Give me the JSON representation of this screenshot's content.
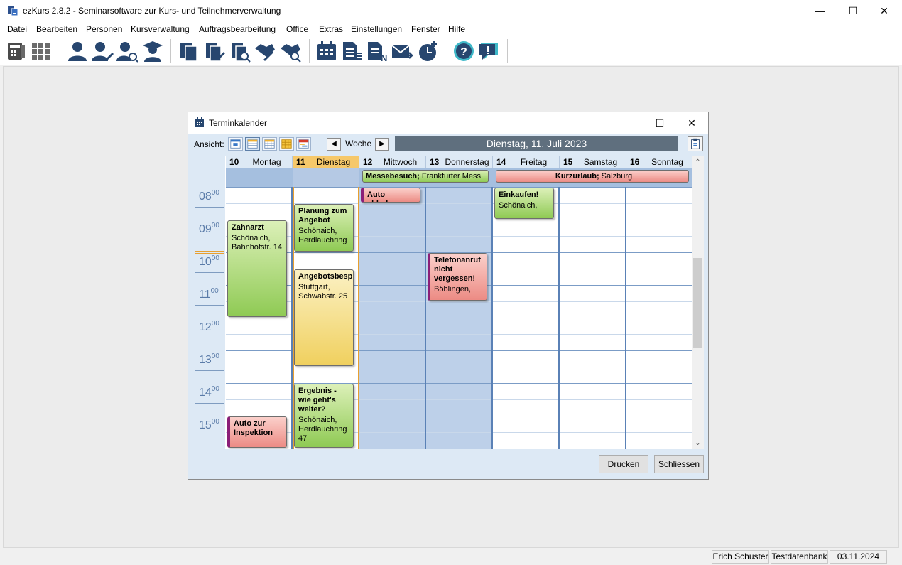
{
  "window": {
    "title": "ezKurs 2.8.2  -  Seminarsoftware zur Kurs- und Teilnehmerverwaltung",
    "minimize": "—",
    "maximize": "☐",
    "close": "✕"
  },
  "menu": [
    "Datei",
    "Bearbeiten",
    "Personen",
    "Kursverwaltung",
    "Auftragsbearbeitung",
    "Office",
    "Extras",
    "Einstellungen",
    "Fenster",
    "Hilfe"
  ],
  "toolbar_icons": [
    "calculator-book",
    "grid-view",
    "person",
    "person-edit",
    "person-search",
    "graduate",
    "documents",
    "document-edit",
    "document-search",
    "handshake-edit",
    "handshake-search",
    "calendar",
    "report-list",
    "report-n",
    "mail-send",
    "timer-add",
    "help",
    "feedback"
  ],
  "dialog": {
    "title": "Terminkalender",
    "ansicht_label": "Ansicht:",
    "woche_label": "Woche",
    "prev": "◀",
    "next": "▶",
    "current_date": "Dienstag, 11. Juli 2023",
    "print_button": "Drucken",
    "close_button": "Schliessen",
    "hours": [
      {
        "h": "08",
        "m": "00"
      },
      {
        "h": "09",
        "m": "00"
      },
      {
        "h": "10",
        "m": "00"
      },
      {
        "h": "11",
        "m": "00"
      },
      {
        "h": "12",
        "m": "00"
      },
      {
        "h": "13",
        "m": "00"
      },
      {
        "h": "14",
        "m": "00"
      },
      {
        "h": "15",
        "m": "00"
      }
    ],
    "days": [
      {
        "num": "10",
        "name": "Montag"
      },
      {
        "num": "11",
        "name": "Dienstag"
      },
      {
        "num": "12",
        "name": "Mittwoch"
      },
      {
        "num": "13",
        "name": "Donnerstag"
      },
      {
        "num": "14",
        "name": "Freitag"
      },
      {
        "num": "15",
        "name": "Samstag"
      },
      {
        "num": "16",
        "name": "Sonntag"
      }
    ],
    "allday_events": [
      {
        "title": "Messebesuch;",
        "location": " Frankfurter Mess",
        "color": "green"
      },
      {
        "title": "Kurzurlaub;",
        "location": " Salzburg",
        "color": "red"
      }
    ],
    "events": [
      {
        "title": "Zahnarzt",
        "location": "Schönaich, Bahnhofstr. 14",
        "color": "green",
        "day": "Montag",
        "start": "09:00",
        "end": "12:00"
      },
      {
        "title": "Auto zur Inspektion",
        "location": "",
        "color": "red",
        "day": "Montag",
        "start": "15:00",
        "end": "16:00"
      },
      {
        "title": "Planung zum Angebot",
        "location": "Schönaich, Herdlauchring",
        "color": "green",
        "day": "Dienstag",
        "start": "08:30",
        "end": "10:00"
      },
      {
        "title": "Angebotsbesprechung",
        "location": "Stuttgart, Schwabstr. 25",
        "color": "yellow",
        "day": "Dienstag",
        "start": "10:30",
        "end": "13:30"
      },
      {
        "title": "Ergebnis - wie geht's weiter?",
        "location": "Schönaich, Herdlauchring 47",
        "color": "green",
        "day": "Dienstag",
        "start": "14:00",
        "end": "16:00"
      },
      {
        "title": "Auto abholen",
        "location": "",
        "color": "red",
        "day": "Mittwoch",
        "start": "08:00",
        "end": "08:30"
      },
      {
        "title": "Telefonanruf nicht vergessen!",
        "location": "Böblingen,",
        "color": "red",
        "day": "Donnerstag",
        "start": "10:00",
        "end": "11:30"
      },
      {
        "title": "Einkaufen!",
        "location": "Schönaich,",
        "color": "green",
        "day": "Freitag",
        "start": "08:00",
        "end": "09:00"
      }
    ]
  },
  "status": {
    "user": "Erich Schuster",
    "database": "Testdatenbank",
    "date": "03.11.2024"
  },
  "colors": {
    "green": "#8fca54",
    "yellow": "#f0d05e",
    "red": "#ec8b84",
    "today": "#e8a030",
    "date_bar": "#5f6f7e"
  }
}
